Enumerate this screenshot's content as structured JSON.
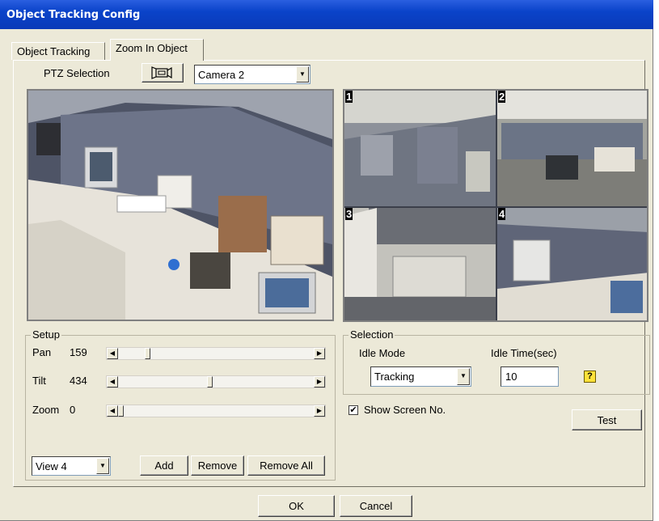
{
  "window": {
    "title": "Object Tracking Config"
  },
  "tabs": [
    {
      "label": "Object Tracking"
    },
    {
      "label": "Zoom In Object"
    }
  ],
  "ptz": {
    "label": "PTZ Selection",
    "camera": "Camera 2"
  },
  "preview": {
    "screen_numbers": [
      "1",
      "2",
      "3",
      "4"
    ]
  },
  "setup": {
    "title": "Setup",
    "pan": {
      "label": "Pan",
      "value": "159",
      "position": 0.14
    },
    "tilt": {
      "label": "Tilt",
      "value": "434",
      "position": 0.47
    },
    "zoom": {
      "label": "Zoom",
      "value": "0",
      "position": 0.0
    },
    "view_select": "View 4",
    "add_label": "Add",
    "remove_label": "Remove",
    "remove_all_label": "Remove All"
  },
  "selection": {
    "title": "Selection",
    "idle_mode_label": "Idle Mode",
    "idle_mode_value": "Tracking",
    "idle_time_label": "Idle Time(sec)",
    "idle_time_value": "10",
    "help_glyph": "?"
  },
  "show_screen_no": {
    "label": "Show Screen No.",
    "checked": true,
    "glyph": "✔"
  },
  "test_label": "Test",
  "ok_label": "OK",
  "cancel_label": "Cancel",
  "icons": {
    "ptz": "ptz-camera-icon",
    "dropdown": "▼",
    "left_arrow": "◀",
    "right_arrow": "▶"
  },
  "colors": {
    "title_bar": "#0a43c9",
    "dialog_bg": "#ece9d8",
    "help_icon": "#ffe23a"
  }
}
